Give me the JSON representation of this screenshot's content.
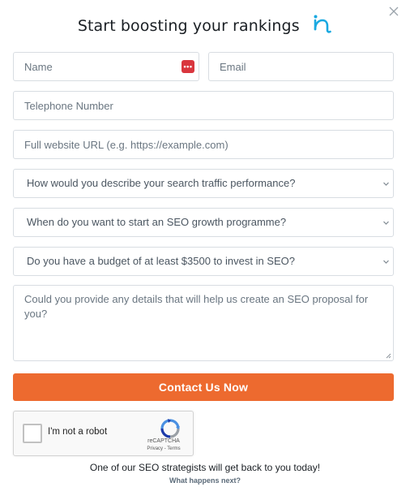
{
  "header": {
    "title": "Start boosting your rankings",
    "logo_icon": "brand-in-logo",
    "logo_color": "#1aa9e1"
  },
  "close": {
    "icon": "close-icon"
  },
  "form": {
    "name_placeholder": "Name",
    "email_placeholder": "Email",
    "phone_placeholder": "Telephone Number",
    "website_placeholder": "Full website URL (e.g. https://example.com)",
    "traffic_select": "How would you describe your search traffic performance?",
    "start_select": "When do you want to start an SEO growth programme?",
    "budget_select": "Do you have a budget of at least $3500 to invest in SEO?",
    "details_placeholder": "Could you provide any details that will help us create an SEO proposal for you?",
    "submit_label": "Contact Us Now",
    "submit_color": "#ed6a2f"
  },
  "recaptcha": {
    "label": "I'm not a robot",
    "brand": "reCAPTCHA",
    "links": "Privacy - Terms"
  },
  "footer": {
    "note": "One of our SEO strategists will get back to you today!",
    "link": "What happens next?"
  }
}
